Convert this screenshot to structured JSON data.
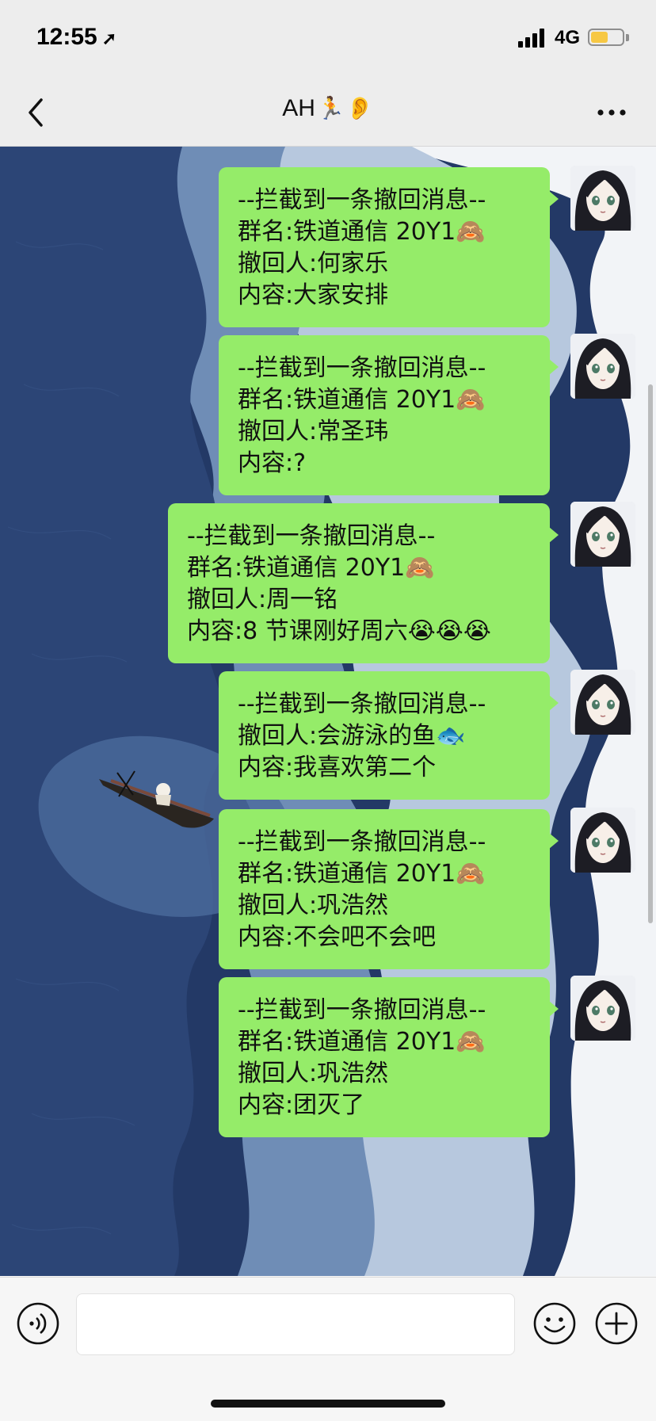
{
  "status": {
    "time": "12:55",
    "location_arrow": "➤",
    "network": "4G",
    "battery_percent": 55,
    "signal_bars": 4
  },
  "nav": {
    "back_icon": "chevron-left",
    "title": "AH",
    "title_emoji": "🏃",
    "title_suffix": "👂",
    "more_icon": "ellipsis"
  },
  "colors": {
    "bubble": "#95ec69",
    "nav_bg": "#ededed",
    "chat_bg": "#233966"
  },
  "messages": [
    {
      "header": "--拦截到一条撤回消息--",
      "lines": [
        "群名:铁道通信 20Y1🙈",
        "撤回人:何家乐",
        "内容:大家安排"
      ]
    },
    {
      "header": "--拦截到一条撤回消息--",
      "lines": [
        "群名:铁道通信 20Y1🙈",
        "撤回人:常圣玮",
        "内容:?"
      ]
    },
    {
      "header": "--拦截到一条撤回消息--",
      "lines": [
        "群名:铁道通信 20Y1🙈",
        "撤回人:周一铭",
        "内容:8 节课刚好周六😭😭😭"
      ]
    },
    {
      "header": "--拦截到一条撤回消息--",
      "lines": [
        "撤回人:会游泳的鱼🐟",
        "内容:我喜欢第二个"
      ]
    },
    {
      "header": "--拦截到一条撤回消息--",
      "lines": [
        "群名:铁道通信 20Y1🙈",
        "撤回人:巩浩然",
        "内容:不会吧不会吧"
      ]
    },
    {
      "header": "--拦截到一条撤回消息--",
      "lines": [
        "群名:铁道通信 20Y1🙈",
        "撤回人:巩浩然",
        "内容:团灭了"
      ]
    }
  ],
  "input": {
    "value": "",
    "voice_icon": "voice-icon",
    "emoji_icon": "smiley-icon",
    "plus_icon": "plus-icon"
  }
}
